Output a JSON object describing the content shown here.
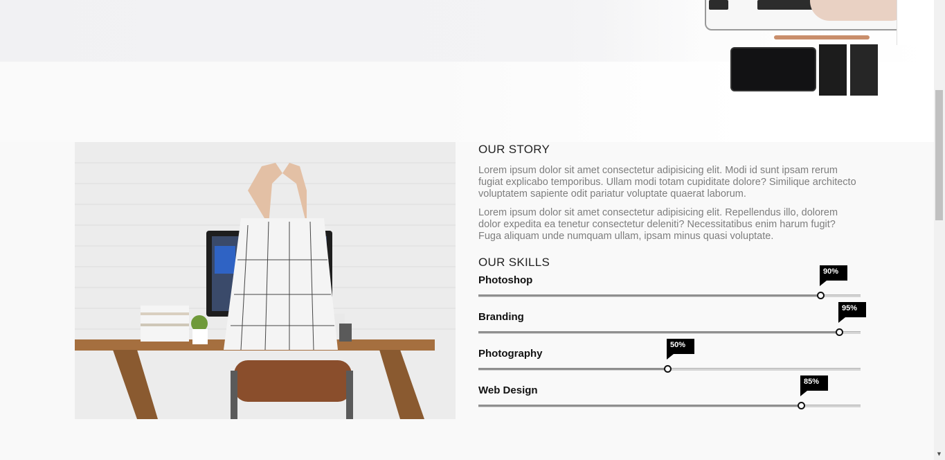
{
  "story": {
    "heading": "OUR STORY",
    "paragraphs": [
      "Lorem ipsum dolor sit amet consectetur adipisicing elit. Modi id sunt ipsam rerum fugiat explicabo temporibus. Ullam modi totam cupiditate dolore? Similique architecto voluptatem sapiente odit pariatur voluptate quaerat laborum.",
      "Lorem ipsum dolor sit amet consectetur adipisicing elit. Repellendus illo, dolorem dolor expedita ea tenetur consectetur deleniti? Necessitatibus enim harum fugit? Fuga aliquam unde numquam ullam, ipsam minus quasi voluptate."
    ]
  },
  "skills": {
    "heading": "OUR SKILLS",
    "items": [
      {
        "label": "Photoshop",
        "value": 90,
        "value_label": "90%"
      },
      {
        "label": "Branding",
        "value": 95,
        "value_label": "95%"
      },
      {
        "label": "Photography",
        "value": 50,
        "value_label": "50%"
      },
      {
        "label": "Web Design",
        "value": 85,
        "value_label": "85%"
      }
    ]
  },
  "colors": {
    "background": "#f9f9f9",
    "text_heading": "#222222",
    "text_body": "#7d7d7d",
    "bubble": "#000000",
    "track": "#d4d4d4"
  },
  "scrollbar": {
    "down_arrow": "chevron-down-icon"
  }
}
